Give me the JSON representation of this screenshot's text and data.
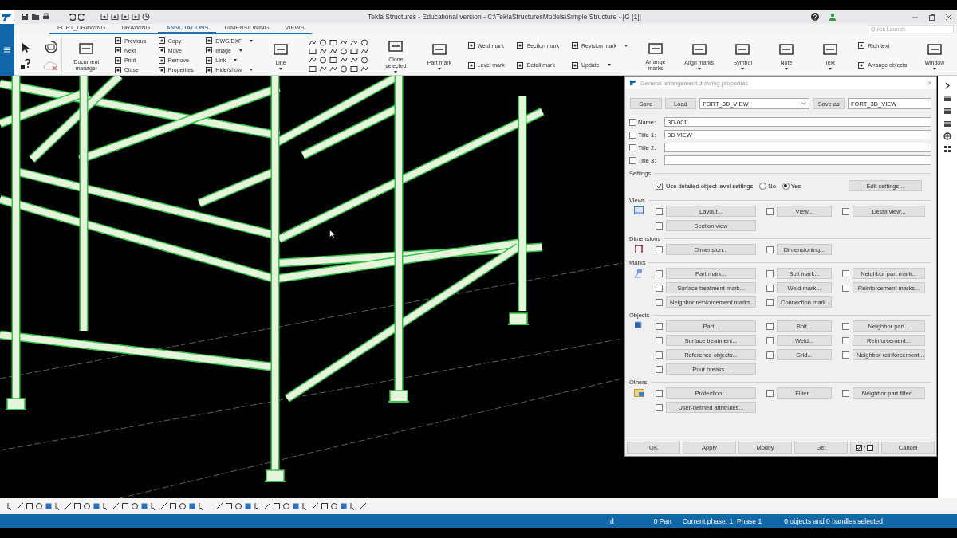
{
  "window": {
    "title": "Tekla Structures - Educational version - C:\\TeklaStructuresModels\\Simple Structure  - [G   [1]]"
  },
  "quick_launch": {
    "placeholder": "Quick Launch"
  },
  "tabs": [
    {
      "label": "FORT_DRAWING",
      "selected": false
    },
    {
      "label": "DRAWING",
      "selected": false
    },
    {
      "label": "ANNOTATIONS",
      "selected": true
    },
    {
      "label": "DIMENSIONING",
      "selected": false
    },
    {
      "label": "VIEWS",
      "selected": false
    }
  ],
  "ribbon": {
    "groups": [
      {
        "kind": "pointer"
      },
      {
        "kind": "history"
      },
      {
        "kind": "large",
        "items": [
          {
            "label": "Document manager",
            "dropdown": false
          }
        ]
      },
      {
        "kind": "small",
        "items": [
          {
            "label": "Previous",
            "dropdown": false
          },
          {
            "label": "Next",
            "dropdown": false
          },
          {
            "label": "Print",
            "dropdown": false
          },
          {
            "label": "Close",
            "dropdown": false
          }
        ]
      },
      {
        "kind": "small",
        "items": [
          {
            "label": "Copy",
            "dropdown": false
          },
          {
            "label": "Move",
            "dropdown": false
          },
          {
            "label": "Remove",
            "dropdown": false
          },
          {
            "label": "Properties",
            "dropdown": false
          }
        ]
      },
      {
        "kind": "small",
        "items": [
          {
            "label": "DWG/DXF",
            "dropdown": true
          },
          {
            "label": "Image",
            "dropdown": true
          },
          {
            "label": "Link",
            "dropdown": true
          },
          {
            "label": "Hide/show",
            "dropdown": true
          }
        ]
      },
      {
        "kind": "large",
        "items": [
          {
            "label": "Line",
            "dropdown": true
          }
        ]
      },
      {
        "kind": "shapes"
      },
      {
        "kind": "large",
        "items": [
          {
            "label": "Clone selected",
            "dropdown": true
          }
        ]
      },
      {
        "kind": "large",
        "items": [
          {
            "label": "Part mark",
            "dropdown": true
          }
        ]
      },
      {
        "kind": "small",
        "items": [
          {
            "label": "Weld mark",
            "dropdown": false
          },
          {
            "label": "Level mark",
            "dropdown": false
          }
        ]
      },
      {
        "kind": "small",
        "items": [
          {
            "label": "Section mark",
            "dropdown": false
          },
          {
            "label": "Detail mark",
            "dropdown": false
          }
        ]
      },
      {
        "kind": "small",
        "items": [
          {
            "label": "Revision mark",
            "dropdown": true
          },
          {
            "label": "Update",
            "dropdown": true
          }
        ]
      },
      {
        "kind": "large",
        "items": [
          {
            "label": "Arrange marks",
            "dropdown": false
          }
        ]
      },
      {
        "kind": "large",
        "items": [
          {
            "label": "Align marks",
            "dropdown": true
          }
        ]
      },
      {
        "kind": "large",
        "items": [
          {
            "label": "Symbol",
            "dropdown": true
          }
        ]
      },
      {
        "kind": "large",
        "items": [
          {
            "label": "Note",
            "dropdown": true
          }
        ]
      },
      {
        "kind": "large",
        "items": [
          {
            "label": "Text",
            "dropdown": true
          }
        ]
      },
      {
        "kind": "small",
        "items": [
          {
            "label": "Rich text",
            "dropdown": false
          },
          {
            "label": "Arrange objects",
            "dropdown": false
          }
        ]
      },
      {
        "kind": "large",
        "items": [
          {
            "label": "Window",
            "dropdown": true
          }
        ]
      }
    ]
  },
  "dialog": {
    "title": "General arrangement drawing properties",
    "close": "×",
    "save": "Save",
    "load": "Load",
    "preset": "FORT_3D_VIEW",
    "save_as": "Save as",
    "save_as_name": "FORT_3D_VIEW",
    "fields": [
      {
        "label": "Name:",
        "value": "3D-001",
        "checked": false
      },
      {
        "label": "Title 1:",
        "value": "3D VIEW",
        "checked": false
      },
      {
        "label": "Title 2:",
        "checked": false
      },
      {
        "label": "Title 3:",
        "checked": false
      }
    ],
    "settings": {
      "title": "Settings",
      "option": "Use detailed object level settings",
      "checked": true,
      "radios": [
        {
          "label": "No",
          "selected": false
        },
        {
          "label": "Yes",
          "selected": true
        }
      ],
      "button": "Edit settings..."
    },
    "sections": [
      {
        "title": "Views",
        "kind": "views",
        "rows": [
          [
            {
              "label": "Layout...",
              "checked": false
            },
            {
              "label": "View...",
              "checked": false
            },
            {
              "label": "Detail view...",
              "checked": false
            }
          ],
          [
            {
              "label": "Section view",
              "checked": false
            }
          ]
        ]
      },
      {
        "title": "Dimensions",
        "kind": "dimensions",
        "rows": [
          [
            {
              "label": "Dimension...",
              "checked": false
            },
            {
              "label": "Dimensioning...",
              "checked": false
            }
          ]
        ]
      },
      {
        "title": "Marks",
        "kind": "marks",
        "rows": [
          [
            {
              "label": "Part mark...",
              "checked": false
            },
            {
              "label": "Bolt mark...",
              "checked": false
            },
            {
              "label": "Neighbor part mark...",
              "checked": false
            }
          ],
          [
            {
              "label": "Surface treatment mark...",
              "checked": false
            },
            {
              "label": "Weld mark...",
              "checked": false
            },
            {
              "label": "Reinforcement marks...",
              "checked": false
            }
          ],
          [
            {
              "label": "Neighbor reinforcement marks...",
              "checked": false
            },
            {
              "label": "Connection mark...",
              "checked": false
            }
          ]
        ]
      },
      {
        "title": "Objects",
        "kind": "objects",
        "rows": [
          [
            {
              "label": "Part...",
              "checked": false
            },
            {
              "label": "Bolt...",
              "checked": false
            },
            {
              "label": "Neighbor part...",
              "checked": false
            }
          ],
          [
            {
              "label": "Surface treatment...",
              "checked": false
            },
            {
              "label": "Weld...",
              "checked": false
            },
            {
              "label": "Reinforcement...",
              "checked": false
            }
          ],
          [
            {
              "label": "Reference objects...",
              "checked": false
            },
            {
              "label": "Grid...",
              "checked": false
            },
            {
              "label": "Neighbor reinforcement...",
              "checked": false
            }
          ],
          [
            {
              "label": "Pour breaks...",
              "checked": false
            }
          ]
        ]
      },
      {
        "title": "Others",
        "kind": "others",
        "rows": [
          [
            {
              "label": "Protection...",
              "checked": false
            },
            {
              "label": "Filter...",
              "checked": false
            },
            {
              "label": "Neighbor part filter...",
              "checked": false
            }
          ],
          [
            {
              "label": "User-defined attributes...",
              "checked": false
            }
          ]
        ]
      }
    ],
    "buttons": {
      "ok": "OK",
      "apply": "Apply",
      "modify": "Modify",
      "get": "Get",
      "toggle_separator": "/",
      "cancel": "Cancel"
    }
  },
  "status_bar": {
    "items": [
      "d",
      "0 Pan",
      "Current phase: 1, Phase 1",
      "0 objects and 0 handles selected"
    ]
  }
}
